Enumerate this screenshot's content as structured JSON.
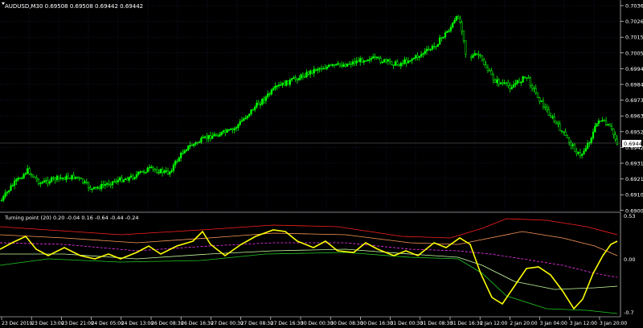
{
  "main_chart": {
    "title": "AUDUSD,M30  0.69508 0.69508 0.69442 0.69442",
    "current_price": "0.69442",
    "price_labels": [
      "0.70365",
      "0.70260",
      "0.70155",
      "0.70050",
      "0.69945",
      "0.69840",
      "0.69735",
      "0.69630",
      "0.69525",
      "0.69420",
      "0.69315",
      "0.69210",
      "0.69105",
      "0.69000"
    ]
  },
  "indicator": {
    "title": "Turning point (20) 0.20 -0.04 0.16 -0.64 -0.44 -0.24",
    "labels": [
      "0.53",
      "0.00",
      "-0.7"
    ]
  },
  "time_labels": [
    "23 Dec 2019",
    "23 Dec 13:00",
    "23 Dec 21:00",
    "24 Dec 05:00",
    "24 Dec 13:00",
    "26 Dec 08:30",
    "26 Dec 16:30",
    "27 Dec 00:30",
    "27 Dec 08:30",
    "27 Dec 16:30",
    "30 Dec 00:30",
    "30 Dec 08:30",
    "30 Dec 16:30",
    "31 Dec 00:30",
    "31 Dec 08:30",
    "31 Dec 16:30",
    "2 Jan 12:00",
    "2 Jan 20:00",
    "3 Jan 04:00",
    "3 Jan 12:00",
    "3 Jan 20:00"
  ],
  "colors": {
    "background": "#000000",
    "candle_up": "#00ff00",
    "candle_down": "#00ff00",
    "grid": "#1e2a55",
    "axis_text": "#ffffff",
    "indicator_main": "#ffff00",
    "band_red": "#ff2020",
    "band_orange": "#ff9a5a",
    "band_magenta": "#ff33ff",
    "band_lightgreen": "#c8ffa0",
    "band_green": "#22cc22"
  }
}
